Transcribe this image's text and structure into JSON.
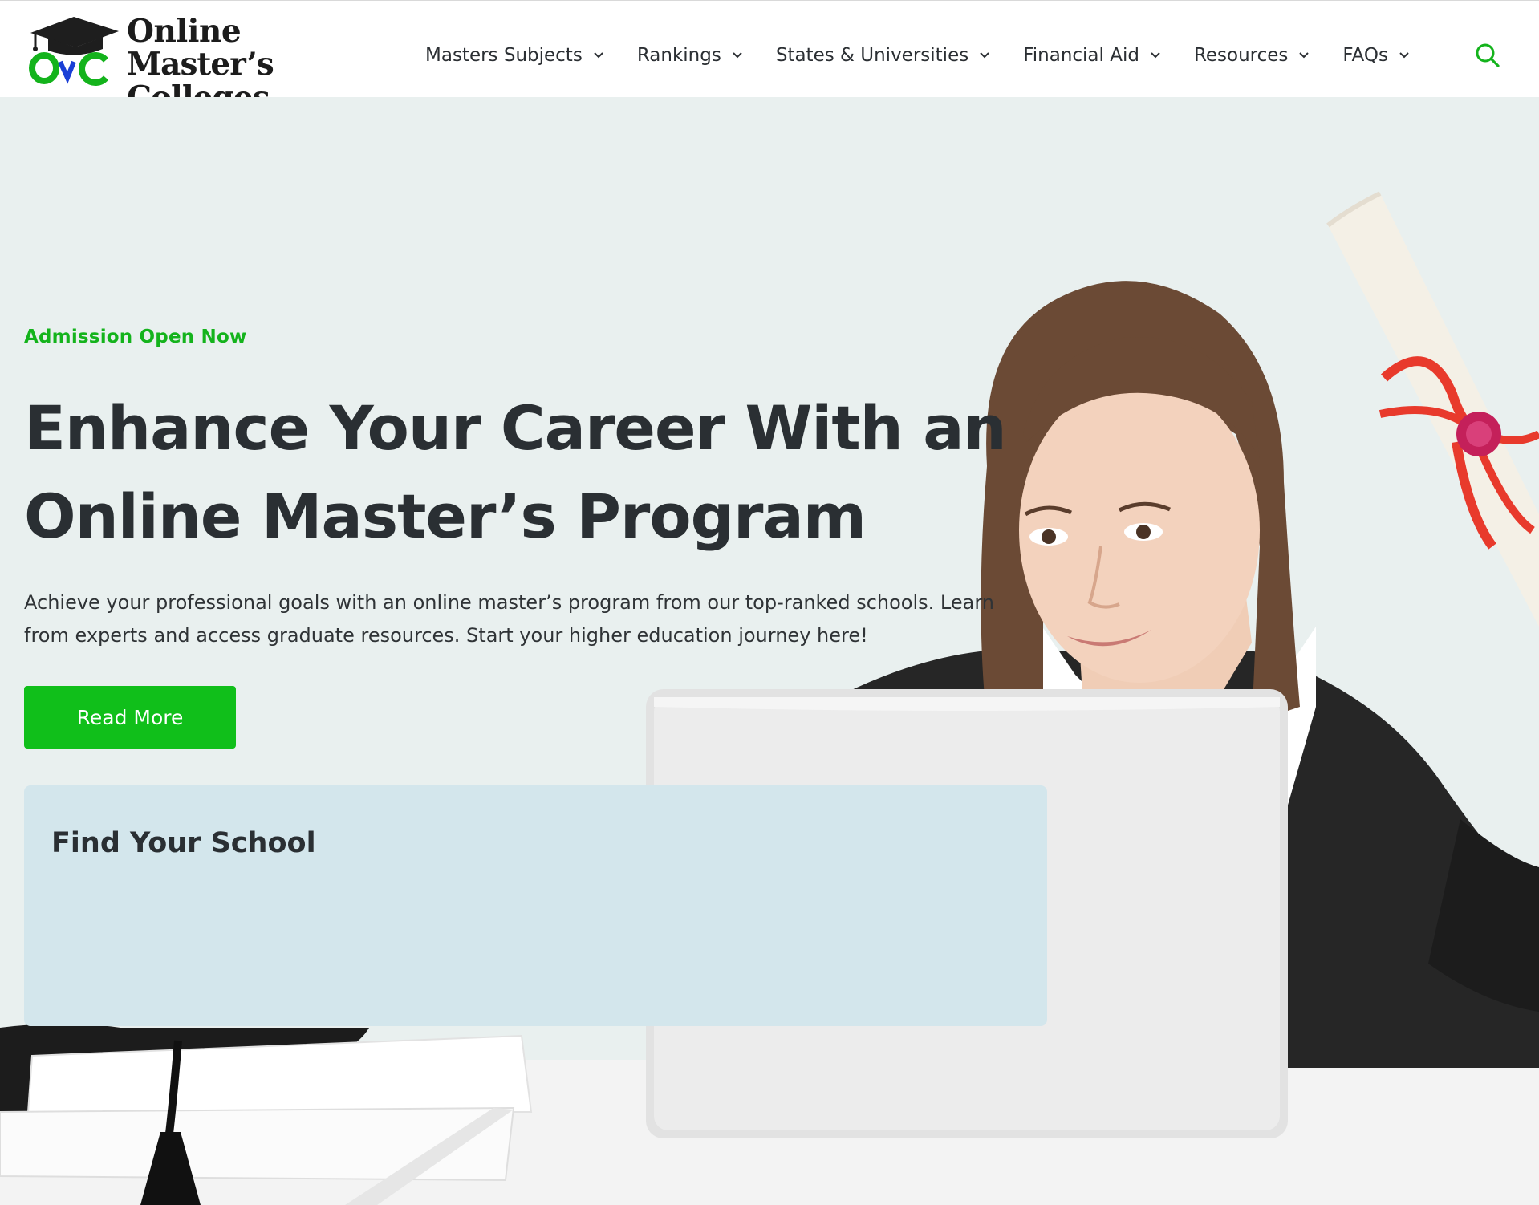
{
  "colors": {
    "accent_green": "#10bf1a",
    "hero_background": "#e9f0ef",
    "finder_background": "#d3e6ec",
    "text_dark": "#2a2f33",
    "logo_blue": "#1a3fd6"
  },
  "logo": {
    "line1": "Online",
    "line2": "Master’s Colleges",
    "icon": "graduation-cap-icon"
  },
  "nav": {
    "items": [
      {
        "label": "Masters Subjects",
        "icon": "chevron-down-icon"
      },
      {
        "label": "Rankings",
        "icon": "chevron-down-icon"
      },
      {
        "label": "States & Universities",
        "icon": "chevron-down-icon"
      },
      {
        "label": "Financial Aid",
        "icon": "chevron-down-icon"
      },
      {
        "label": "Resources",
        "icon": "chevron-down-icon"
      },
      {
        "label": "FAQs",
        "icon": "chevron-down-icon"
      }
    ],
    "search_icon": "search-icon"
  },
  "hero": {
    "eyebrow": "Admission Open Now",
    "headline_line1": "Enhance Your Career With an",
    "headline_line2": "Online Master’s Program",
    "lead": "Achieve your professional goals with an online master’s program from our top-ranked schools. Learn from experts and access graduate resources. Start your higher education journey here!",
    "cta_label": "Read More"
  },
  "finder": {
    "title": "Find Your School"
  }
}
